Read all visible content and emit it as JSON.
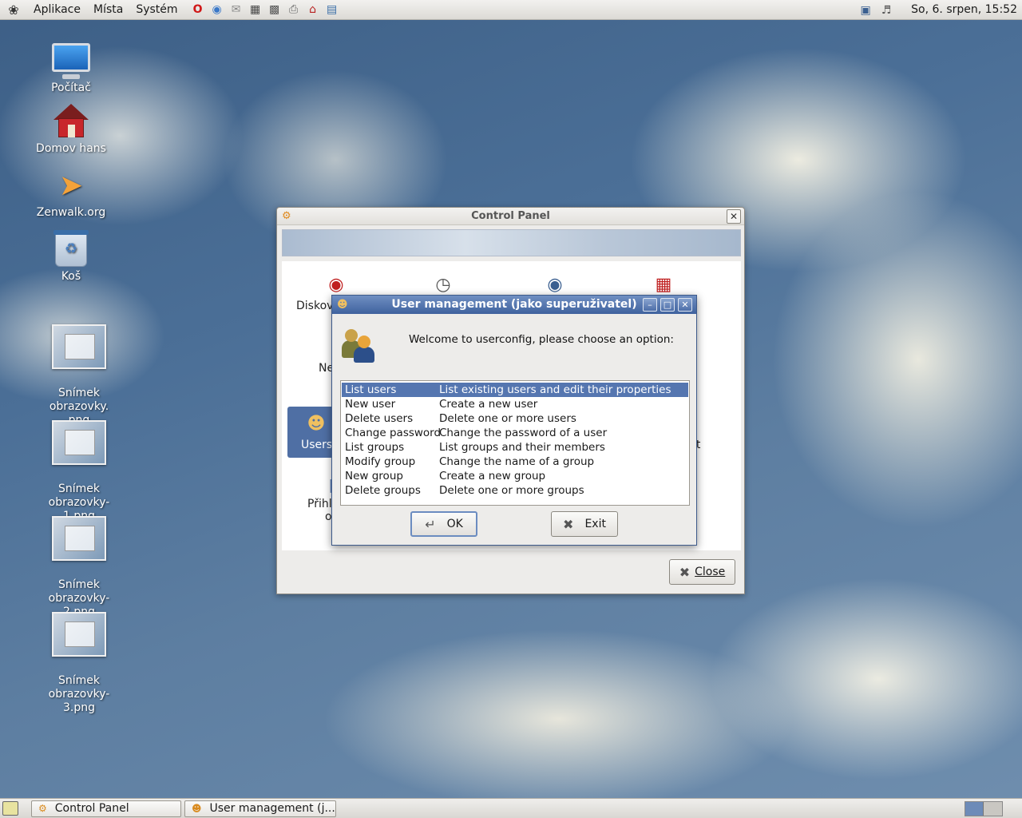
{
  "top_panel": {
    "menu": [
      "Aplikace",
      "Místa",
      "Systém"
    ],
    "launchers": [
      "opera-icon",
      "browser-icon",
      "mail-icon",
      "video-icon",
      "terminal-icon",
      "printer-icon",
      "home-icon",
      "network-icon"
    ],
    "clock": "So,  6. srpen, 15:52"
  },
  "desktop_icons": [
    {
      "label": "Počítač"
    },
    {
      "label": "Domov hans"
    },
    {
      "label": "Zenwalk.org"
    },
    {
      "label": "Koš"
    },
    {
      "label": "Snímek obrazovky.\npng"
    },
    {
      "label": "Snímek obrazovky-\n1.png"
    },
    {
      "label": "Snímek obrazovky-\n2.png"
    },
    {
      "label": "Snímek obrazovky-\n3.png"
    }
  ],
  "control_panel": {
    "title": "Control Panel",
    "items": [
      {
        "label": "Diskov",
        "icon": "disk-icon"
      },
      {
        "label": "",
        "icon": "clock-icon"
      },
      {
        "label": "",
        "icon": "package-icon"
      },
      {
        "label": "",
        "icon": "firewall-icon"
      },
      {
        "label": "Ne",
        "icon": "network-icon"
      },
      {
        "label": "Users",
        "icon": "users-icon"
      },
      {
        "label": "ut",
        "icon": "layout-icon"
      },
      {
        "label": "Přihla",
        "icon": "login-icon"
      },
      {
        "label": "o",
        "icon": ""
      }
    ],
    "close_label": "Close"
  },
  "user_management": {
    "title": "User management (jako superuživatel)",
    "welcome": "Welcome to userconfig, please choose an option:",
    "options": [
      {
        "name": "List users",
        "description": "List existing users and edit their properties"
      },
      {
        "name": "New user",
        "description": "Create a new user"
      },
      {
        "name": "Delete users",
        "description": "Delete one or more users"
      },
      {
        "name": "Change password",
        "description": "Change the password of a user"
      },
      {
        "name": "List groups",
        "description": "List groups and their members"
      },
      {
        "name": "Modify group",
        "description": "Change the name of a group"
      },
      {
        "name": "New group",
        "description": "Create a new group"
      },
      {
        "name": "Delete groups",
        "description": "Delete one or more groups"
      }
    ],
    "selected_index": 0,
    "ok_label": "OK",
    "exit_label": "Exit"
  },
  "taskbar": {
    "tasks": [
      "Control Panel",
      "User management (j..."
    ]
  },
  "colors": {
    "selection": "#5576b0",
    "titlebar_active": "#4f6fa4",
    "desktop_sky": "#4b6f97"
  }
}
